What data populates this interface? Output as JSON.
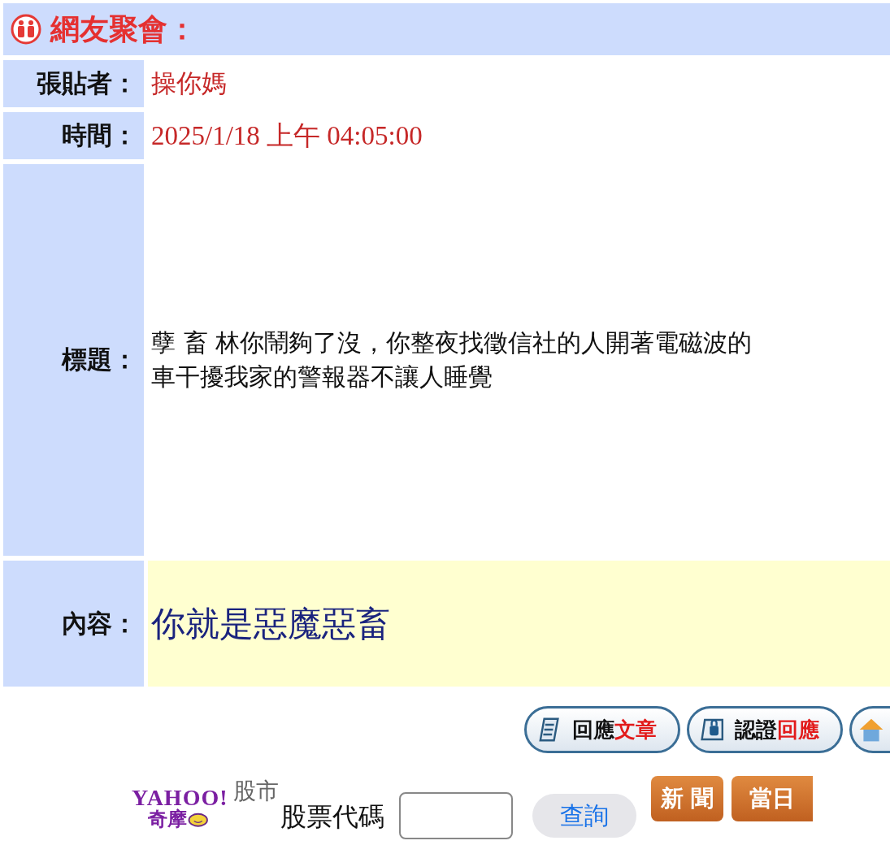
{
  "header": {
    "title": "網友聚會："
  },
  "fields": [
    {
      "kind": "author",
      "label": "張貼者：",
      "value": "操你媽"
    },
    {
      "kind": "time",
      "label": "時間：",
      "value": "2025/1/18 上午 04:05:00"
    },
    {
      "kind": "subject",
      "label": "標題：",
      "value": "孽 畜 林你鬧夠了沒，你整夜找徵信社的人開著電磁波的車干擾我家的警報器不讓人睡覺"
    },
    {
      "kind": "content",
      "label": "內容：",
      "value": "你就是惡魔惡畜"
    }
  ],
  "actions": [
    {
      "kind": "reply",
      "label": "回應",
      "accent": "文章"
    },
    {
      "kind": "verified",
      "label": "認證",
      "accent": "回應"
    },
    {
      "kind": "home"
    }
  ],
  "stock": {
    "logo_top": "YAHOO!",
    "logo_bottom": "奇摩",
    "section": "股市",
    "field_label": "股票代碼",
    "button": "查詢",
    "tabs": [
      "新 聞",
      "當日"
    ]
  }
}
